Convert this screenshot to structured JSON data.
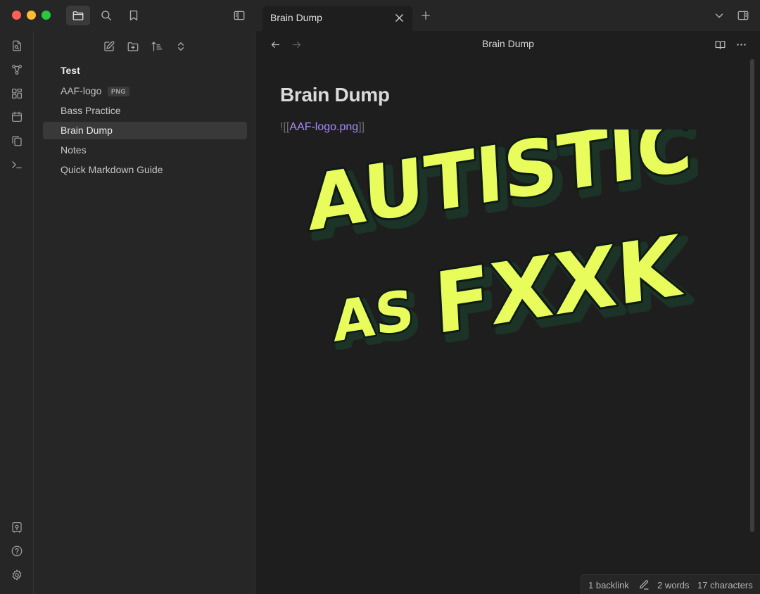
{
  "window": {
    "tab": {
      "title": "Brain Dump"
    }
  },
  "explorer": {
    "folder": "Test",
    "files": [
      {
        "name": "AAF-logo",
        "badge": "PNG"
      },
      {
        "name": "Bass Practice"
      },
      {
        "name": "Brain Dump",
        "active": true
      },
      {
        "name": "Notes"
      },
      {
        "name": "Quick Markdown Guide"
      }
    ]
  },
  "view": {
    "header_title": "Brain Dump",
    "note_title": "Brain Dump",
    "embed": {
      "open": "![[",
      "link": "AAF-logo.png",
      "close": "]]"
    },
    "image": {
      "line1": "AUTISTIC",
      "line2_small": "AS",
      "line2_big": "FXXK"
    }
  },
  "status": {
    "backlinks": "1 backlink",
    "words": "2 words",
    "characters": "17 characters"
  },
  "colors": {
    "accent": "#a88bfa",
    "logo_fill": "#e8fd5c",
    "logo_shadow": "#1c3328"
  },
  "icons": {
    "titlebar": [
      "folder-icon",
      "search-icon",
      "bookmark-icon",
      "sidebar-toggle-icon",
      "new-tab-icon",
      "chevron-down-icon",
      "right-sidebar-icon"
    ],
    "ribbon": [
      "file-search-icon",
      "graph-icon",
      "canvas-icon",
      "calendar-icon",
      "copy-icon",
      "terminal-icon",
      "vault-icon",
      "help-icon",
      "settings-icon"
    ]
  }
}
